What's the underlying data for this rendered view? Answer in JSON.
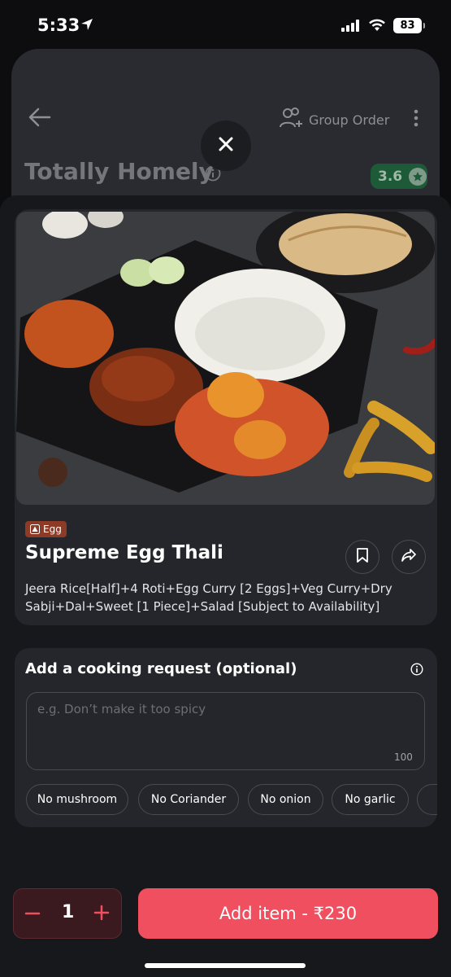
{
  "status_bar": {
    "time": "5:33",
    "battery": "83"
  },
  "restaurant": {
    "name": "Totally Homely",
    "rating": "3.6",
    "group_order_label": "Group Order"
  },
  "item": {
    "tag": "Egg",
    "title": "Supreme Egg Thali",
    "description": "Jeera Rice[Half]+4 Roti+Egg Curry [2 Eggs]+Veg Curry+Dry Sabji+Dal+Sweet [1 Piece]+Salad [Subject to Availability]"
  },
  "cooking_request": {
    "title": "Add a cooking request (optional)",
    "placeholder": "e.g. Don’t make it too spicy",
    "char_limit": "100",
    "chips": [
      "No mushroom",
      "No Coriander",
      "No onion",
      "No garlic"
    ]
  },
  "cart": {
    "quantity": "1",
    "add_label": "Add item - ₹230"
  },
  "colors": {
    "accent": "#ef4f5f",
    "rating_bg": "#1d5a37",
    "egg_tag": "#8d3a26"
  }
}
